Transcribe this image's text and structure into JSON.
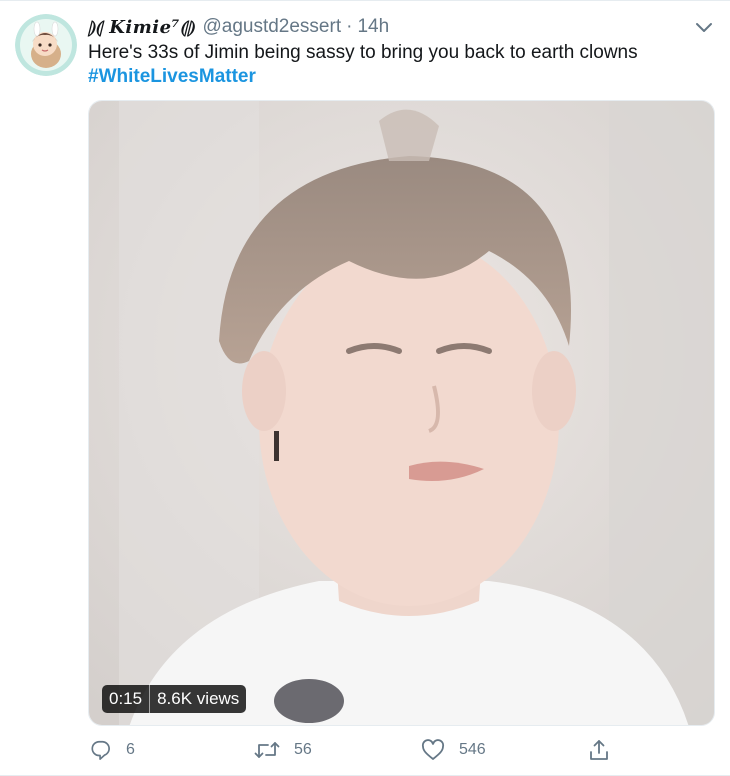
{
  "tweet": {
    "display_name": "⦈⦇ 𝑲𝒊𝒎𝒊𝒆⁷⦇⦈",
    "handle": "@agustd2essert",
    "separator": "·",
    "time": "14h",
    "text_line1": "Here's 33s of Jimin being sassy to bring you back to earth clowns",
    "hashtag": "#WhiteLivesMatter"
  },
  "media": {
    "duration": "0:15",
    "views": "8.6K views"
  },
  "actions": {
    "reply_count": "6",
    "retweet_count": "56",
    "like_count": "546"
  },
  "icons": {
    "more": "chevron-down-icon",
    "reply": "comment-icon",
    "retweet": "retweet-icon",
    "like": "heart-icon",
    "share": "share-icon"
  },
  "colors": {
    "link": "#1b95e0",
    "muted": "#657786",
    "text": "#14171a"
  }
}
